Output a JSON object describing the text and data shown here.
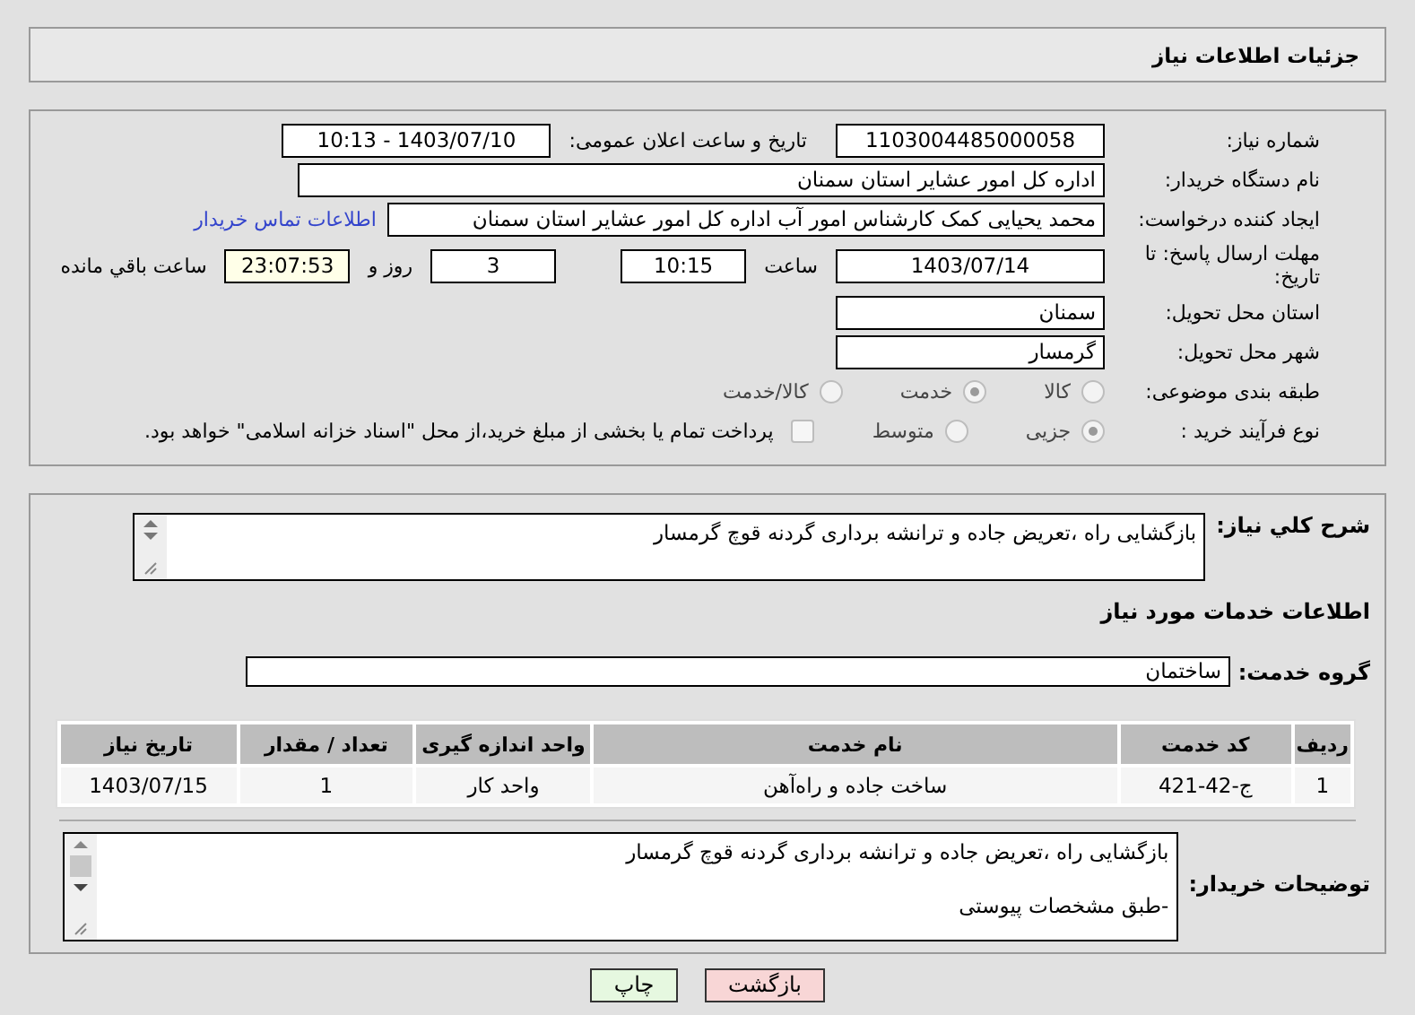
{
  "header": {
    "title": "جزئیات اطلاعات نیاز"
  },
  "details": {
    "need_number": {
      "label": "شماره نیاز:",
      "value": "1103004485000058"
    },
    "announce": {
      "label": "تاریخ و ساعت اعلان عمومی:",
      "value": "1403/07/10 - 10:13"
    },
    "buyer": {
      "label": "نام دستگاه خریدار:",
      "value": "اداره کل امور عشایر استان سمنان"
    },
    "creator": {
      "label": "ایجاد کننده درخواست:",
      "value": "محمد یحیایی کمک کارشناس امور آب اداره کل امور عشایر استان سمنان",
      "link": "اطلاعات تماس خریدار"
    },
    "deadline": {
      "label": "مهلت ارسال پاسخ: تا تاریخ:",
      "date": "1403/07/14",
      "time_label": "ساعت",
      "time": "10:15",
      "days": "3",
      "days_label": "روز و",
      "remaining": "23:07:53",
      "remaining_label": "ساعت باقي مانده"
    },
    "province": {
      "label": "استان محل تحویل:",
      "value": "سمنان"
    },
    "city": {
      "label": "شهر محل تحویل:",
      "value": "گرمسار"
    },
    "category": {
      "label": "طبقه بندی موضوعی:",
      "options": [
        {
          "label": "کالا",
          "selected": false
        },
        {
          "label": "خدمت",
          "selected": true
        },
        {
          "label": "کالا/خدمت",
          "selected": false
        }
      ]
    },
    "process": {
      "label": "نوع فرآیند خرید :",
      "options": [
        {
          "label": "جزیی",
          "selected": true
        },
        {
          "label": "متوسط",
          "selected": false
        }
      ],
      "treasury": {
        "label": "پرداخت تمام یا بخشی از مبلغ خرید،از محل \"اسناد خزانه اسلامی\" خواهد بود.",
        "checked": false
      }
    }
  },
  "summary": {
    "label": "شرح کلي نیاز:",
    "value": "بازگشایی راه ،تعریض جاده و ترانشه برداری گردنه قوچ گرمسار"
  },
  "services": {
    "title": "اطلاعات خدمات مورد نیاز",
    "group": {
      "label": "گروه خدمت:",
      "value": "ساختمان"
    },
    "table": {
      "columns": [
        "ردیف",
        "کد خدمت",
        "نام خدمت",
        "واحد اندازه گیری",
        "تعداد / مقدار",
        "تاریخ نیاز"
      ],
      "rows": [
        [
          "1",
          "ج-42-421",
          "ساخت جاده و راه‌آهن",
          "واحد کار",
          "1",
          "1403/07/15"
        ]
      ]
    }
  },
  "buyer_notes": {
    "label": "توضیحات خریدار:",
    "lines": [
      "بازگشایی راه ،تعریض جاده و ترانشه برداری گردنه قوچ گرمسار",
      "-طبق مشخصات پیوستی"
    ]
  },
  "buttons": [
    {
      "label": "بازگشت",
      "kind": "back"
    },
    {
      "label": "چاپ",
      "kind": "print"
    }
  ]
}
